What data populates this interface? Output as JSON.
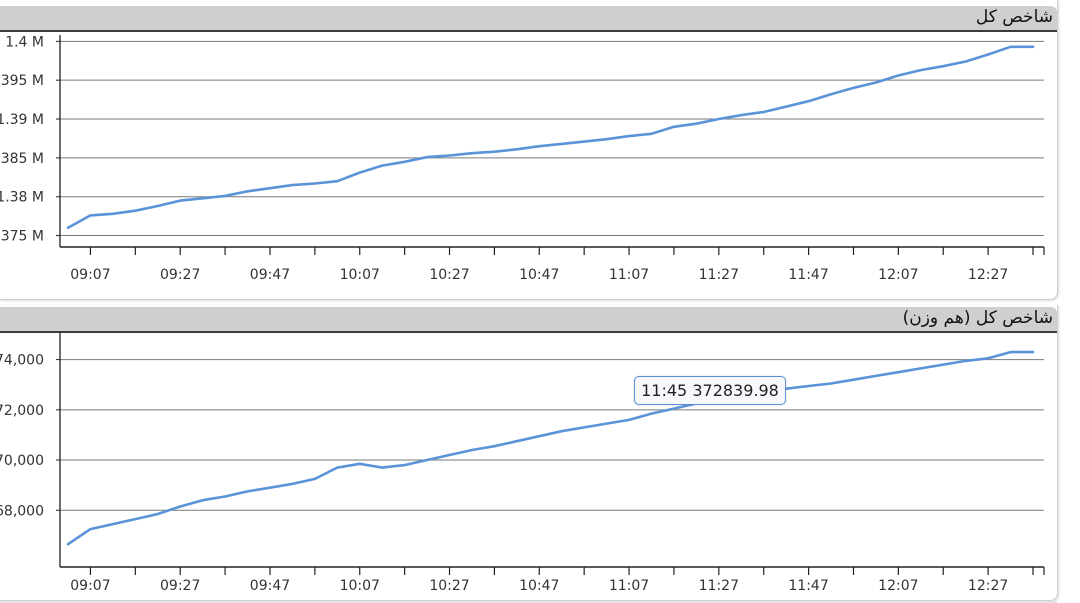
{
  "panels": [
    {
      "title": "شاخص کل"
    },
    {
      "title": "شاخص کل (هم وزن)"
    }
  ],
  "tooltip": {
    "time": "11:45",
    "value": "372839.98"
  },
  "colors": {
    "line": "#5b93d9",
    "grid": "#7a7a7a",
    "axis": "#222222",
    "header_bg": "#cfcfcf"
  },
  "chart_data": [
    {
      "type": "line",
      "title": "شاخص کل",
      "xlabel": "",
      "ylabel": "",
      "x_ticks": [
        "09:07",
        "09:27",
        "09:47",
        "10:07",
        "10:27",
        "10:47",
        "11:07",
        "11:27",
        "11:47",
        "12:07",
        "12:27"
      ],
      "y_ticks": [
        {
          "value": 1400000,
          "label": "1.4 M"
        },
        {
          "value": 1395000,
          "label": "395 M"
        },
        {
          "value": 1390000,
          "label": "1.39 M"
        },
        {
          "value": 1385000,
          "label": "385 M"
        },
        {
          "value": 1380000,
          "label": "1.38 M"
        },
        {
          "value": 1375000,
          "label": "375 M"
        }
      ],
      "ylim": [
        1374300,
        1400300
      ],
      "grid": true,
      "series": [
        {
          "values": [
            {
              "x": "09:02",
              "y": 1376000
            },
            {
              "x": "09:07",
              "y": 1377600
            },
            {
              "x": "09:12",
              "y": 1377800
            },
            {
              "x": "09:17",
              "y": 1378200
            },
            {
              "x": "09:22",
              "y": 1378800
            },
            {
              "x": "09:27",
              "y": 1379500
            },
            {
              "x": "09:32",
              "y": 1379800
            },
            {
              "x": "09:37",
              "y": 1380100
            },
            {
              "x": "09:42",
              "y": 1380700
            },
            {
              "x": "09:47",
              "y": 1381100
            },
            {
              "x": "09:52",
              "y": 1381500
            },
            {
              "x": "09:57",
              "y": 1381700
            },
            {
              "x": "10:02",
              "y": 1382000
            },
            {
              "x": "10:07",
              "y": 1383100
            },
            {
              "x": "10:12",
              "y": 1384000
            },
            {
              "x": "10:17",
              "y": 1384500
            },
            {
              "x": "10:22",
              "y": 1385100
            },
            {
              "x": "10:27",
              "y": 1385300
            },
            {
              "x": "10:32",
              "y": 1385600
            },
            {
              "x": "10:37",
              "y": 1385800
            },
            {
              "x": "10:42",
              "y": 1386100
            },
            {
              "x": "10:47",
              "y": 1386500
            },
            {
              "x": "10:52",
              "y": 1386800
            },
            {
              "x": "10:57",
              "y": 1387100
            },
            {
              "x": "11:02",
              "y": 1387400
            },
            {
              "x": "11:07",
              "y": 1387800
            },
            {
              "x": "11:12",
              "y": 1388100
            },
            {
              "x": "11:17",
              "y": 1389000
            },
            {
              "x": "11:22",
              "y": 1389400
            },
            {
              "x": "11:27",
              "y": 1390000
            },
            {
              "x": "11:32",
              "y": 1390500
            },
            {
              "x": "11:37",
              "y": 1390900
            },
            {
              "x": "11:42",
              "y": 1391600
            },
            {
              "x": "11:47",
              "y": 1392300
            },
            {
              "x": "11:52",
              "y": 1393200
            },
            {
              "x": "11:57",
              "y": 1394000
            },
            {
              "x": "12:02",
              "y": 1394700
            },
            {
              "x": "12:07",
              "y": 1395600
            },
            {
              "x": "12:12",
              "y": 1396300
            },
            {
              "x": "12:17",
              "y": 1396800
            },
            {
              "x": "12:22",
              "y": 1397400
            },
            {
              "x": "12:27",
              "y": 1398300
            },
            {
              "x": "12:32",
              "y": 1399300
            },
            {
              "x": "12:37",
              "y": 1399300
            }
          ]
        }
      ]
    },
    {
      "type": "line",
      "title": "شاخص کل (هم وزن)",
      "xlabel": "",
      "ylabel": "",
      "x_ticks": [
        "09:07",
        "09:27",
        "09:47",
        "10:07",
        "10:27",
        "10:47",
        "11:07",
        "11:27",
        "11:47",
        "12:07",
        "12:27"
      ],
      "y_ticks": [
        {
          "value": 374000,
          "label": "74,000"
        },
        {
          "value": 372000,
          "label": "72,000"
        },
        {
          "value": 370000,
          "label": "70,000"
        },
        {
          "value": 368000,
          "label": "68,000"
        }
      ],
      "ylim": [
        365980,
        374900
      ],
      "grid": true,
      "series": [
        {
          "values": [
            {
              "x": "09:02",
              "y": 366650
            },
            {
              "x": "09:07",
              "y": 367250
            },
            {
              "x": "09:12",
              "y": 367450
            },
            {
              "x": "09:17",
              "y": 367650
            },
            {
              "x": "09:22",
              "y": 367850
            },
            {
              "x": "09:27",
              "y": 368150
            },
            {
              "x": "09:32",
              "y": 368400
            },
            {
              "x": "09:37",
              "y": 368550
            },
            {
              "x": "09:42",
              "y": 368750
            },
            {
              "x": "09:47",
              "y": 368900
            },
            {
              "x": "09:52",
              "y": 369050
            },
            {
              "x": "09:57",
              "y": 369250
            },
            {
              "x": "10:02",
              "y": 369700
            },
            {
              "x": "10:07",
              "y": 369850
            },
            {
              "x": "10:12",
              "y": 369700
            },
            {
              "x": "10:17",
              "y": 369800
            },
            {
              "x": "10:22",
              "y": 370000
            },
            {
              "x": "10:27",
              "y": 370200
            },
            {
              "x": "10:32",
              "y": 370400
            },
            {
              "x": "10:37",
              "y": 370550
            },
            {
              "x": "10:42",
              "y": 370750
            },
            {
              "x": "10:47",
              "y": 370950
            },
            {
              "x": "10:52",
              "y": 371150
            },
            {
              "x": "10:57",
              "y": 371300
            },
            {
              "x": "11:02",
              "y": 371450
            },
            {
              "x": "11:07",
              "y": 371600
            },
            {
              "x": "11:12",
              "y": 371850
            },
            {
              "x": "11:17",
              "y": 372050
            },
            {
              "x": "11:22",
              "y": 372250
            },
            {
              "x": "11:27",
              "y": 372450
            },
            {
              "x": "11:32",
              "y": 372600
            },
            {
              "x": "11:37",
              "y": 372700
            },
            {
              "x": "11:42",
              "y": 372840
            },
            {
              "x": "11:47",
              "y": 372950
            },
            {
              "x": "11:52",
              "y": 373050
            },
            {
              "x": "11:57",
              "y": 373200
            },
            {
              "x": "12:02",
              "y": 373350
            },
            {
              "x": "12:07",
              "y": 373500
            },
            {
              "x": "12:12",
              "y": 373650
            },
            {
              "x": "12:17",
              "y": 373800
            },
            {
              "x": "12:22",
              "y": 373950
            },
            {
              "x": "12:27",
              "y": 374050
            },
            {
              "x": "12:32",
              "y": 374300
            },
            {
              "x": "12:37",
              "y": 374300
            }
          ]
        }
      ]
    }
  ]
}
